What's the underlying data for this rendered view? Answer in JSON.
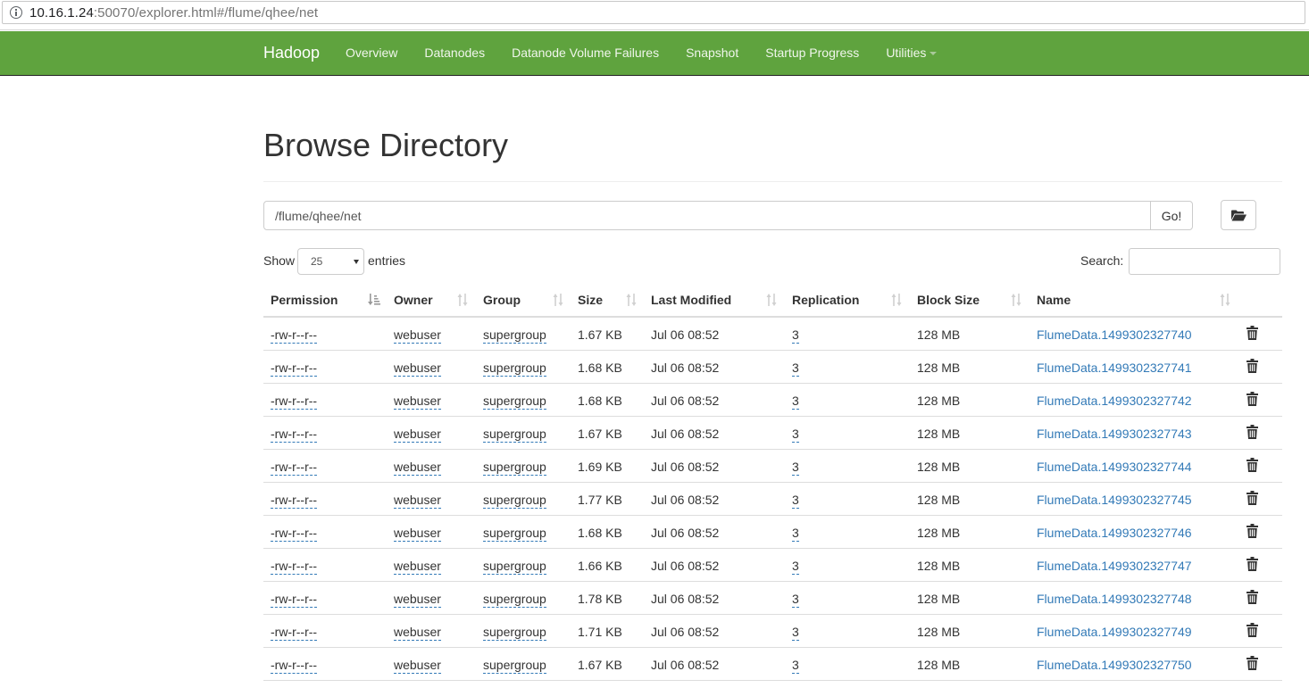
{
  "browser": {
    "url_host": "10.16.1.24",
    "url_rest": ":50070/explorer.html#/flume/qhee/net"
  },
  "navbar": {
    "brand": "Hadoop",
    "items": [
      {
        "label": "Overview"
      },
      {
        "label": "Datanodes"
      },
      {
        "label": "Datanode Volume Failures"
      },
      {
        "label": "Snapshot"
      },
      {
        "label": "Startup Progress"
      },
      {
        "label": "Utilities"
      }
    ],
    "color": "#5fa33e"
  },
  "page": {
    "title": "Browse Directory",
    "path_value": "/flume/qhee/net",
    "go_label": "Go!",
    "show_label": "Show",
    "entries_value": "25",
    "entries_label": "entries",
    "search_label": "Search:"
  },
  "table": {
    "columns": [
      "Permission",
      "Owner",
      "Group",
      "Size",
      "Last Modified",
      "Replication",
      "Block Size",
      "Name"
    ],
    "rows": [
      {
        "permission": "-rw-r--r--",
        "owner": "webuser",
        "group": "supergroup",
        "size": "1.67 KB",
        "modified": "Jul 06 08:52",
        "replication": "3",
        "block_size": "128 MB",
        "name": "FlumeData.1499302327740"
      },
      {
        "permission": "-rw-r--r--",
        "owner": "webuser",
        "group": "supergroup",
        "size": "1.68 KB",
        "modified": "Jul 06 08:52",
        "replication": "3",
        "block_size": "128 MB",
        "name": "FlumeData.1499302327741"
      },
      {
        "permission": "-rw-r--r--",
        "owner": "webuser",
        "group": "supergroup",
        "size": "1.68 KB",
        "modified": "Jul 06 08:52",
        "replication": "3",
        "block_size": "128 MB",
        "name": "FlumeData.1499302327742"
      },
      {
        "permission": "-rw-r--r--",
        "owner": "webuser",
        "group": "supergroup",
        "size": "1.67 KB",
        "modified": "Jul 06 08:52",
        "replication": "3",
        "block_size": "128 MB",
        "name": "FlumeData.1499302327743"
      },
      {
        "permission": "-rw-r--r--",
        "owner": "webuser",
        "group": "supergroup",
        "size": "1.69 KB",
        "modified": "Jul 06 08:52",
        "replication": "3",
        "block_size": "128 MB",
        "name": "FlumeData.1499302327744"
      },
      {
        "permission": "-rw-r--r--",
        "owner": "webuser",
        "group": "supergroup",
        "size": "1.77 KB",
        "modified": "Jul 06 08:52",
        "replication": "3",
        "block_size": "128 MB",
        "name": "FlumeData.1499302327745"
      },
      {
        "permission": "-rw-r--r--",
        "owner": "webuser",
        "group": "supergroup",
        "size": "1.68 KB",
        "modified": "Jul 06 08:52",
        "replication": "3",
        "block_size": "128 MB",
        "name": "FlumeData.1499302327746"
      },
      {
        "permission": "-rw-r--r--",
        "owner": "webuser",
        "group": "supergroup",
        "size": "1.66 KB",
        "modified": "Jul 06 08:52",
        "replication": "3",
        "block_size": "128 MB",
        "name": "FlumeData.1499302327747"
      },
      {
        "permission": "-rw-r--r--",
        "owner": "webuser",
        "group": "supergroup",
        "size": "1.78 KB",
        "modified": "Jul 06 08:52",
        "replication": "3",
        "block_size": "128 MB",
        "name": "FlumeData.1499302327748"
      },
      {
        "permission": "-rw-r--r--",
        "owner": "webuser",
        "group": "supergroup",
        "size": "1.71 KB",
        "modified": "Jul 06 08:52",
        "replication": "3",
        "block_size": "128 MB",
        "name": "FlumeData.1499302327749"
      },
      {
        "permission": "-rw-r--r--",
        "owner": "webuser",
        "group": "supergroup",
        "size": "1.67 KB",
        "modified": "Jul 06 08:52",
        "replication": "3",
        "block_size": "128 MB",
        "name": "FlumeData.1499302327750"
      }
    ],
    "row_action_icon": "trash-icon",
    "sorted_column": "Permission",
    "link_color": "#337ab7"
  }
}
